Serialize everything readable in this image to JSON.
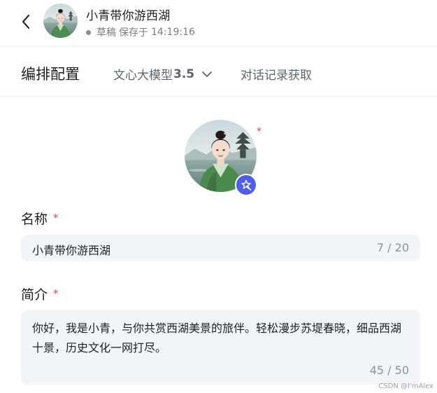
{
  "header": {
    "back_icon": "chevron-left-icon",
    "title": "小青带你游西湖",
    "status_label": "草稿",
    "saved_label": "保存于",
    "saved_time": "14:19:16"
  },
  "tabs": {
    "arrange": "编排配置",
    "model_name": "文心大模型",
    "model_version": "3.5",
    "model_icon": "chevron-down-icon",
    "history": "对话记录获取"
  },
  "avatar": {
    "required_mark": "*",
    "magic_icon": "magic-wand-icon"
  },
  "form": {
    "name": {
      "label": "名称",
      "required_mark": "*",
      "value": "小青带你游西湖",
      "counter": "7 / 20"
    },
    "intro": {
      "label": "简介",
      "required_mark": "*",
      "value": "你好，我是小青，与你共赏西湖美景的旅伴。轻松漫步苏堤春晓，细品西湖十景，历史文化一网打尽。",
      "counter": "45 / 50"
    }
  },
  "watermark": "CSDN @I'mAlex",
  "colors": {
    "accent": "#4e5eea",
    "required": "#e5484d",
    "field_bg": "#f3f4f8",
    "muted_text": "#7a7d86"
  }
}
